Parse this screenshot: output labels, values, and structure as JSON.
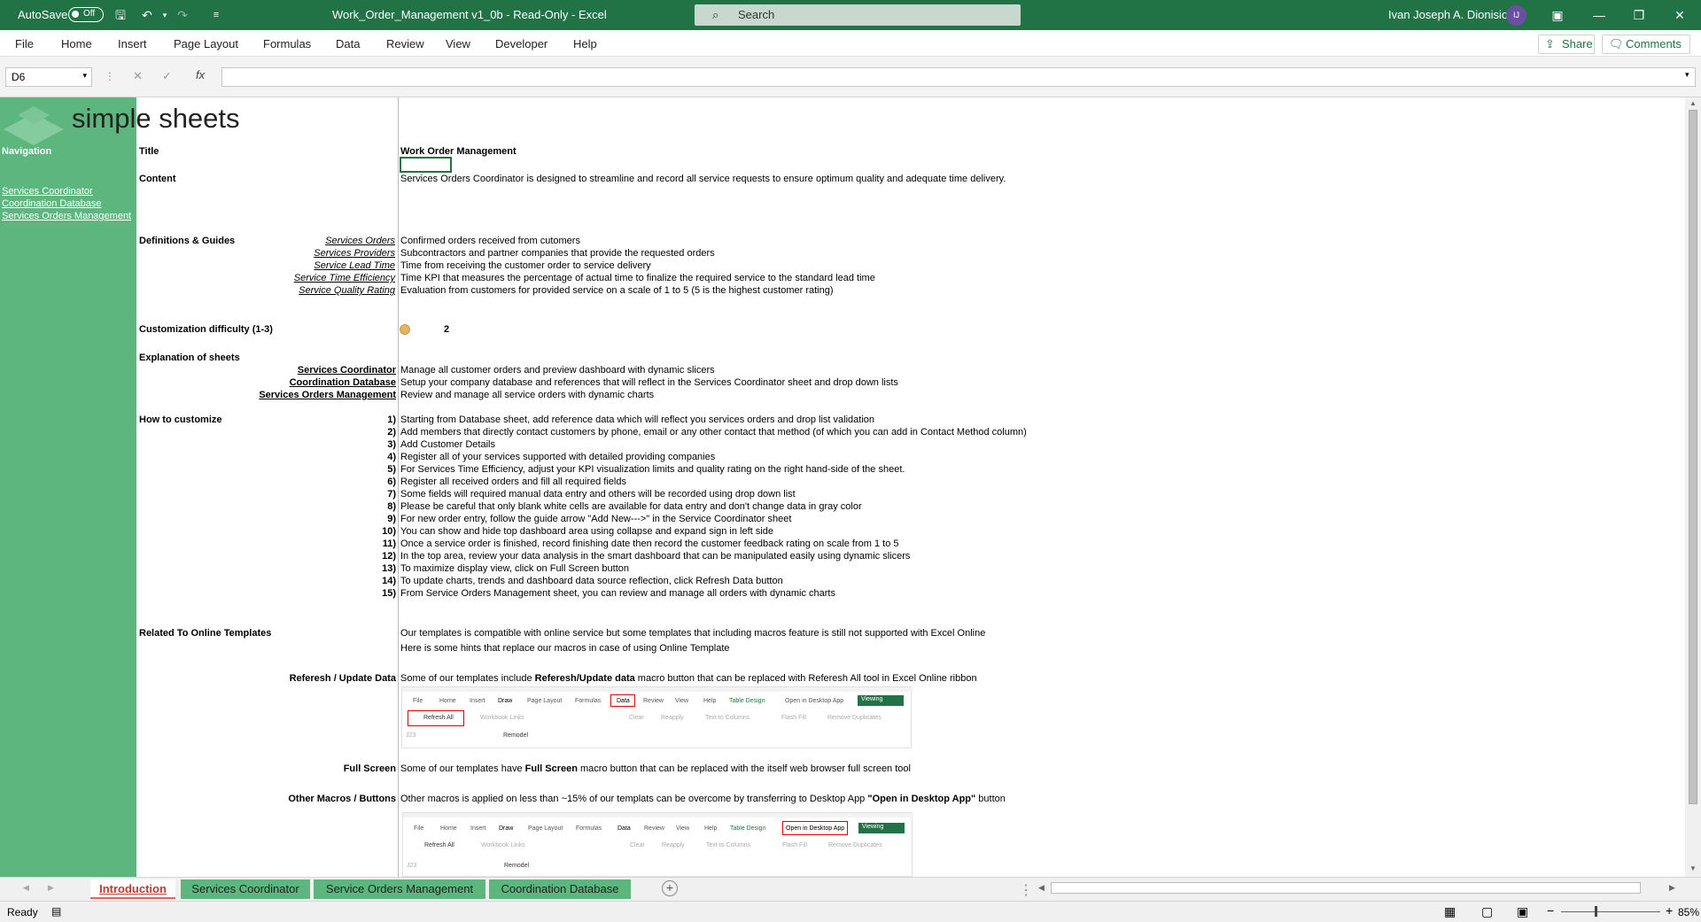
{
  "titlebar": {
    "autosave_label": "AutoSave",
    "autosave_state": "Off",
    "doc_title": "Work_Order_Management v1_0b  -  Read-Only  -  Excel",
    "search_placeholder": "Search",
    "user_name": "Ivan Joseph A. Dionisio",
    "user_initials": "IJ"
  },
  "menu": {
    "items": [
      "File",
      "Home",
      "Insert",
      "Page Layout",
      "Formulas",
      "Data",
      "Review",
      "View",
      "Developer",
      "Help"
    ],
    "share_label": "Share",
    "comments_label": "Comments"
  },
  "formula_bar": {
    "name_box": "D6",
    "fx": "fx",
    "value": ""
  },
  "logo": {
    "text": "simple sheets"
  },
  "navigation": {
    "header": "Navigation",
    "links": [
      "Services Coordinator",
      "Coordination Database",
      "Services Orders Management"
    ]
  },
  "content": {
    "title_label": "Title",
    "title_value": "Work Order Management",
    "content_label": "Content",
    "content_value": "Services Orders Coordinator is designed to streamline and record all service requests to ensure optimum quality and adequate time delivery.",
    "definitions_label": "Definitions & Guides",
    "definitions": [
      {
        "term": "Services Orders",
        "desc": "Confirmed orders received from cutomers"
      },
      {
        "term": "Services Providers",
        "desc": "Subcontractors and partner companies that provide the requested orders"
      },
      {
        "term": "Service Lead Time",
        "desc": "Time from receiving the customer order to service delivery"
      },
      {
        "term": "Service Time Efficiency",
        "desc": "Time KPI that measures the percentage of actual time to finalize the required service to the standard lead time"
      },
      {
        "term": "Service Quality Rating",
        "desc": "Evaluation from customers for provided service on a scale of 1 to 5 (5 is the highest customer rating)"
      }
    ],
    "difficulty_label": "Customization difficulty (1-3)",
    "difficulty_value": "2",
    "explanation_label": "Explanation of sheets",
    "sheets": [
      {
        "name": "Services Coordinator",
        "desc": "Manage all customer orders and preview dashboard with dynamic slicers"
      },
      {
        "name": "Coordination Database",
        "desc": "Setup your company database and references that will reflect in the Services Coordinator sheet and drop down lists"
      },
      {
        "name": "Services Orders Management",
        "desc": "Review and manage all service orders with dynamic charts"
      }
    ],
    "howto_label": "How to customize",
    "steps": [
      "Starting from Database sheet, add reference data which will reflect you services orders and drop list validation",
      "Add members that directly contact customers by phone, email or any other contact that method (of which you can add in Contact Method column)",
      "Add Customer Details",
      "Register all of your services supported with detailed providing companies",
      "For Services Time Efficiency, adjust your KPI visualization limits and quality rating on the right hand-side of the sheet.",
      "Register all received orders and fill all required fields",
      "Some fields will required manual data entry and others will be recorded using drop down list",
      "Please be careful that only blank white cells are available for data entry and don't change data in gray color",
      "For new order entry, follow the guide arrow \"Add New--->\" in the Service Coordinator sheet",
      "You can show and hide top dashboard area using collapse and expand sign in left side",
      "Once a service order is finished, record finishing date then record the customer feedback rating on scale from 1 to 5",
      "In the top area, review your data analysis in the smart dashboard that can be manipulated easily using dynamic slicers",
      "To maximize display view, click on Full Screen button",
      "To update charts, trends and dashboard data source reflection, click Refresh Data button",
      "From Service Orders Management sheet, you can review and manage all orders with dynamic charts"
    ],
    "step_numbers": [
      "1)",
      "2)",
      "3)",
      "4)",
      "5)",
      "6)",
      "7)",
      "8)",
      "9)",
      "10)",
      "11)",
      "12)",
      "13)",
      "14)",
      "15)"
    ],
    "online_label": "Related To Online Templates",
    "online_line1": "Our templates is compatible with online service but some templates that including macros feature is still not supported with Excel Online",
    "online_line2": "Here is some hints that replace our macros in case of using Online Template",
    "refresh_label": "Referesh / Update Data",
    "refresh_pre": "Some of our templates include ",
    "refresh_bold": "Referesh/Update data",
    "refresh_post": " macro button that can be replaced with Referesh All tool in Excel Online ribbon",
    "fullscreen_label": "Full Screen",
    "fullscreen_pre": "Some of our templates have ",
    "fullscreen_bold": "Full Screen",
    "fullscreen_post": " macro button that can be replaced with the itself web browser full screen tool",
    "macros_label": "Other Macros / Buttons",
    "macros_pre": "Other macros is applied on less than ~15% of our templats can be overcome by transferring to Desktop App ",
    "macros_bold": "\"Open in Desktop App\"",
    "macros_post": " button"
  },
  "ribbon_shot": {
    "tabs": [
      "File",
      "Home",
      "Insert",
      "Draw",
      "Page Layout",
      "Formulas",
      "Data",
      "Review",
      "View",
      "Help",
      "Table Design"
    ],
    "open_desktop": "Open in Desktop App",
    "viewing": "Viewing",
    "refresh_all": "Refresh All",
    "tools": [
      "Workbook Links",
      "Clear",
      "Reapply",
      "Text to Columns",
      "Flash Fill",
      "Remove Duplicates"
    ],
    "cell_ref": "J23",
    "cell_value": "Remodel"
  },
  "sheet_tabs": {
    "tabs": [
      "Introduction",
      "Services Coordinator",
      "Service Orders Management",
      "Coordination Database"
    ],
    "active": "Introduction",
    "colors": {
      "active": "#e06666",
      "green": "#5cb67e"
    }
  },
  "status": {
    "ready": "Ready",
    "zoom": "85%"
  },
  "colors": {
    "excel_green": "#217346",
    "nav_green": "#5cb67e",
    "difficulty_dot": "#e6b460"
  }
}
